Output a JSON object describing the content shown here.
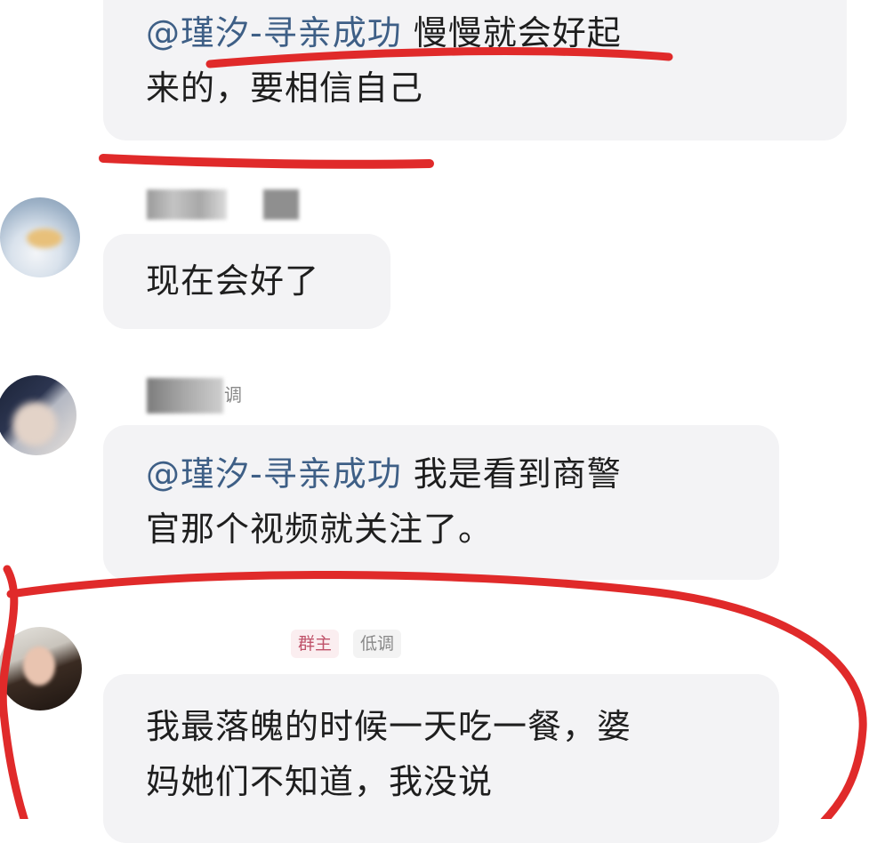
{
  "messages": [
    {
      "mention": "@瑾汐-寻亲成功",
      "text_line1": " 慢慢就会好起",
      "text_line2": "来的，要相信自己"
    },
    {
      "text": "现在会好了"
    },
    {
      "name_fragment": "调",
      "mention": "@瑾汐-寻亲成功",
      "text_line1": " 我是看到商警",
      "text_line2": "官那个视频就关注了。"
    },
    {
      "role_badge": "群主",
      "status_badge": "低调",
      "text_line1": "我最落魄的时候一天吃一餐，婆",
      "text_line2": "妈她们不知道，我没说"
    }
  ],
  "colors": {
    "bubble": "#f3f3f5",
    "mention": "#3e5f86",
    "annotation": "#e02a2a",
    "owner_badge": "#c0536a",
    "badge_text": "#888888"
  }
}
